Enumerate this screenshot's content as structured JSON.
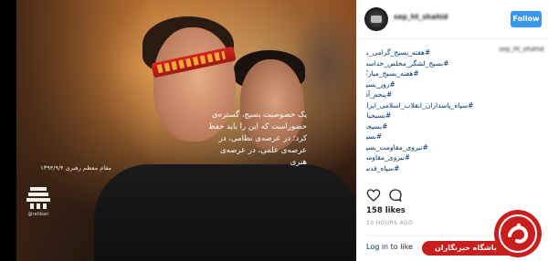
{
  "photo": {
    "quote_lines": [
      "یک خصوصیت بسیج، گستره‌ی",
      "حضوراست که این را باید حفظ",
      "کرد؛ در عرصه‌ی نظامی، در",
      "عرصه‌ی علمی، در عرصه‌ی هنری"
    ],
    "signature": "مقام معظم رهبری ۱۳۹۴/۹/۴",
    "logo_caption": "@rahbari"
  },
  "post": {
    "username": "sep_ht_shahid",
    "follow_label": "Follow",
    "caption_username": "sep_ht_shahid",
    "hashtags": [
      "#هفته_بسیج_گرامی_باد",
      "#بسیج_لشگر_مخلص_خداست",
      "#هفته_بسیج_مبارک",
      "#روز_بسیج",
      "#پنجم_آذر",
      "#سپاه_پاسداران_انقلاب_اسلامی_ایران",
      "#بسیجیان",
      "#بسیجی",
      "#بسیج",
      "#نیروی_مقاومت_بسیج",
      "#نیروی_مقاومت",
      "#سپاه_قدس"
    ],
    "likes": "158 likes",
    "timestamp": "10 HOURS AGO",
    "login_link": "Log in",
    "login_rest": " to like"
  },
  "watermark": {
    "text": "باشگاه خبرنگاران"
  },
  "colors": {
    "follow_button": "#3897f0",
    "hashtag": "#003569",
    "watermark": "#c91e1e"
  },
  "icons": [
    "heart-icon",
    "comment-icon",
    "avatar",
    "brand-logo-icon",
    "watermark-logo-icon"
  ]
}
